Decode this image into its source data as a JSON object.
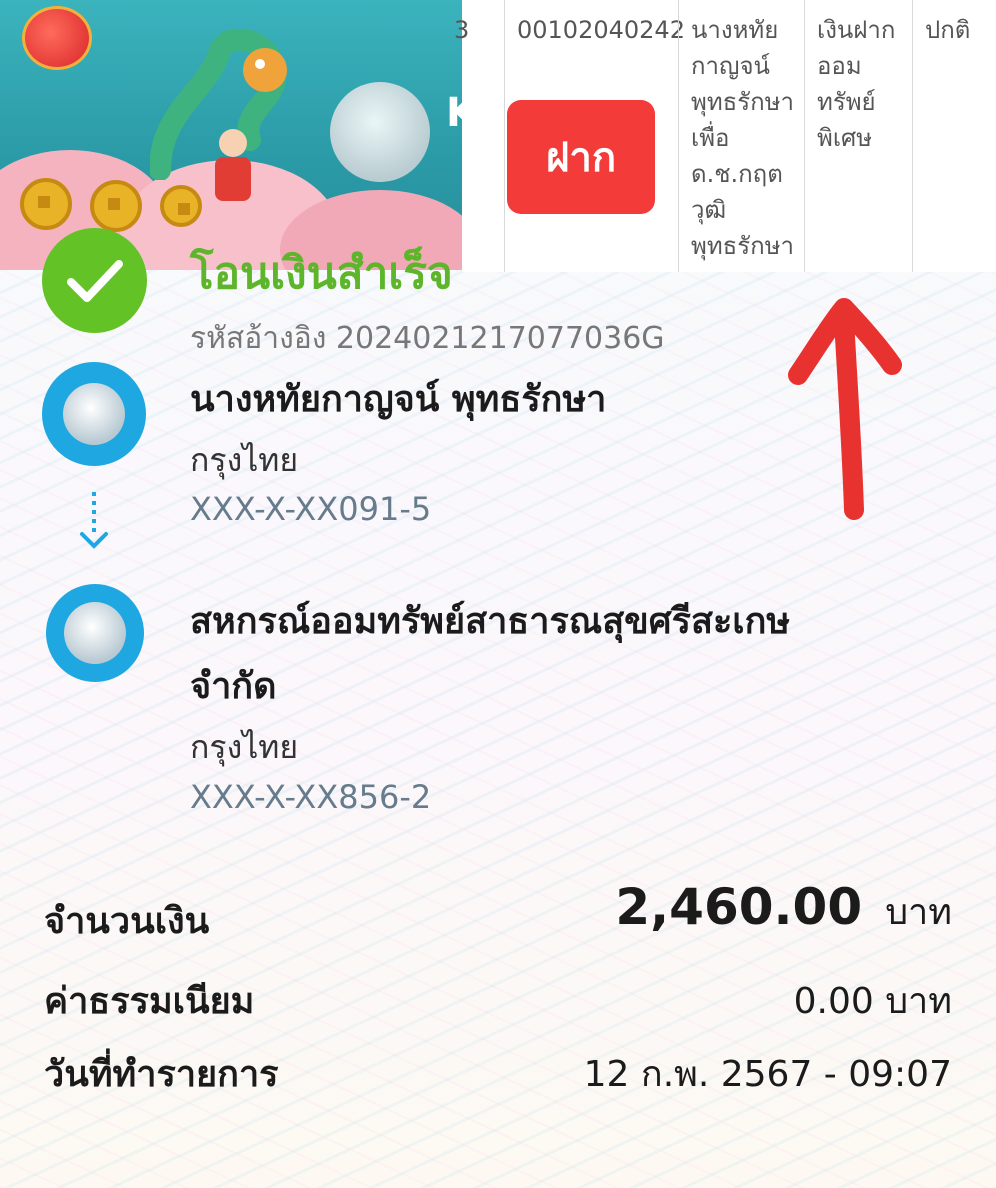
{
  "banner": {
    "brand_text": "K"
  },
  "header": {
    "status_title": "โอนเงินสำเร็จ",
    "reference": "รหัสอ้างอิง 2024021217077036G"
  },
  "sender": {
    "name": "นางหทัยกาญจน์ พุทธรักษา",
    "bank": "กรุงไทย",
    "account": "XXX-X-XX091-5"
  },
  "recipient": {
    "name_line1": "สหกรณ์ออมทรัพย์สาธารณสุขศรีสะเกษ",
    "name_line2": "จำกัด",
    "bank": "กรุงไทย",
    "account": "XXX-X-XX856-2"
  },
  "summary": {
    "amount_label": "จำนวนเงิน",
    "amount_value": "2,460.00",
    "amount_unit": "บาท",
    "fee_label": "ค่าธรรมเนียม",
    "fee_value": "0.00 บาท",
    "date_label": "วันที่ทำรายการ",
    "date_value": "12 ก.พ. 2567 - 09:07"
  },
  "overlay_table": {
    "col0": "3",
    "col1": "00102040242",
    "col2": "นางหทัย\nกาญจน์\nพุทธรักษา\nเพื่อ\nด.ช.กฤต\nวุฒิ\nพุทธรักษา",
    "col3": "เงินฝาก\nออม\nทรัพย์\nพิเศษ",
    "col4": "ปกติ",
    "deposit_button": "ฝาก"
  },
  "colors": {
    "success": "#5db52a",
    "ktb_blue": "#1ea7e1",
    "deposit_red": "#f33b3a",
    "annotation_red": "#e8322f"
  }
}
